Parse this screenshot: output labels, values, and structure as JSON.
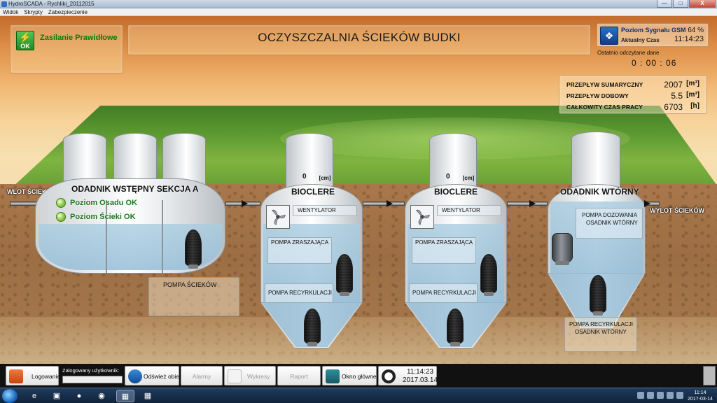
{
  "window": {
    "title": "HydroSCADA - Rychliki_20112015",
    "min_label": "—",
    "max_label": "□",
    "close_label": "X"
  },
  "menu": [
    "Widok",
    "Skrypty",
    "Zabezpieczenie"
  ],
  "power": {
    "icon_text": "OK",
    "status": "Zasilanie Prawidłowe"
  },
  "header": {
    "title": "OCZYSZCZALNIA ŚCIEKÓW BUDKI"
  },
  "gsm": {
    "label": "Poziom Sygnału GSM",
    "value": "64 %",
    "time_label": "Aktualny Czas",
    "time_value": "11:14:23",
    "last_read_label": "Ostatnio odczytane dane",
    "last_read_value": "0 : 00 : 06"
  },
  "stats": [
    {
      "label": "PRZEPŁYW SUMARYCZNY",
      "value": "2007",
      "unit": "[m³]"
    },
    {
      "label": "PRZEPŁYW DOBOWY",
      "value": "5.5",
      "unit": "[m³]"
    },
    {
      "label": "CAŁKOWITY CZAS PRACY",
      "value": "6703",
      "unit": "[h]"
    }
  ],
  "inlet_label": "WLOT ŚCIEKÓW",
  "outlet_label": "WYLOT ŚCIEKÓW",
  "tank_a": {
    "label": "ODADNIK WSTĘPNY SEKCJA A",
    "sludge_status": "Poziom Osadu OK",
    "sewage_status": "Poziom Ścieki OK",
    "pump_label": "POMPA ŚCIEKÓW"
  },
  "bioclere1": {
    "label": "BIOCLERE",
    "level": "0",
    "unit": "[cm]",
    "fan_label": "WENTYLATOR",
    "spray_pump": "POMPA ZRASZAJĄCA",
    "recirc_pump": "POMPA RECYRKULACJI"
  },
  "bioclere2": {
    "label": "BIOCLERE",
    "level": "0",
    "unit": "[cm]",
    "fan_label": "WENTYLATOR",
    "spray_pump": "POMPA ZRASZAJĄCA",
    "recirc_pump": "POMPA RECYRKULACJI"
  },
  "secondary": {
    "label": "ODADNIK WTÓRNY",
    "dosing_pump_line1": "POMPA DOZOWANIA",
    "dosing_pump_line2": "OSADNIK WTÓRNY",
    "recirc_line1": "POMPA RECYRKULACJI",
    "recirc_line2": "OSADNIK WTÓRNY"
  },
  "toolbar": {
    "login": "Logowanie",
    "logged_user": "Zalogowany użytkownik:",
    "refresh": "Odśwież obiekt",
    "alarms": "Alarmy",
    "charts": "Wykresy",
    "report": "Raport",
    "main_window": "Okno główne",
    "clock_time": "11:14:23",
    "clock_date": "2017.03.14"
  },
  "taskbar": {
    "time": "11:14",
    "date": "2017-03-14"
  }
}
